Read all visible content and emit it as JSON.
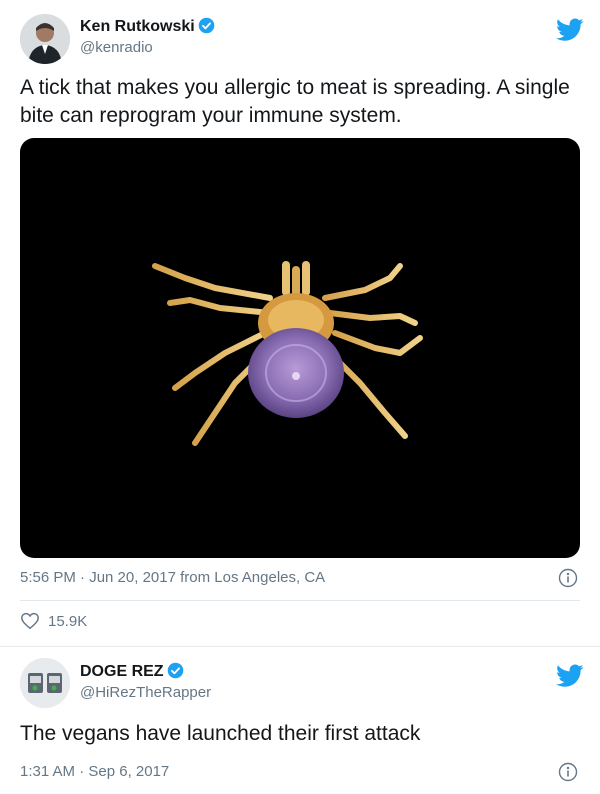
{
  "tweet1": {
    "name": "Ken Rutkowski",
    "handle": "@kenradio",
    "text": "A tick that makes you allergic to meat is spreading. A single bite can reprogram your immune system.",
    "timestamp": "5:56 PM · Jun 20, 2017 from Los Angeles, CA",
    "likes": "15.9K"
  },
  "tweet2": {
    "name": "DOGE REZ",
    "handle": "@HiRezTheRapper",
    "text": "The vegans have launched their first attack",
    "timestamp": "1:31 AM · Sep 6, 2017"
  },
  "colors": {
    "twitter_blue": "#1da1f2",
    "secondary_text": "#657786"
  },
  "icons": [
    "verified-badge-icon",
    "twitter-bird-icon",
    "info-icon",
    "heart-icon"
  ]
}
